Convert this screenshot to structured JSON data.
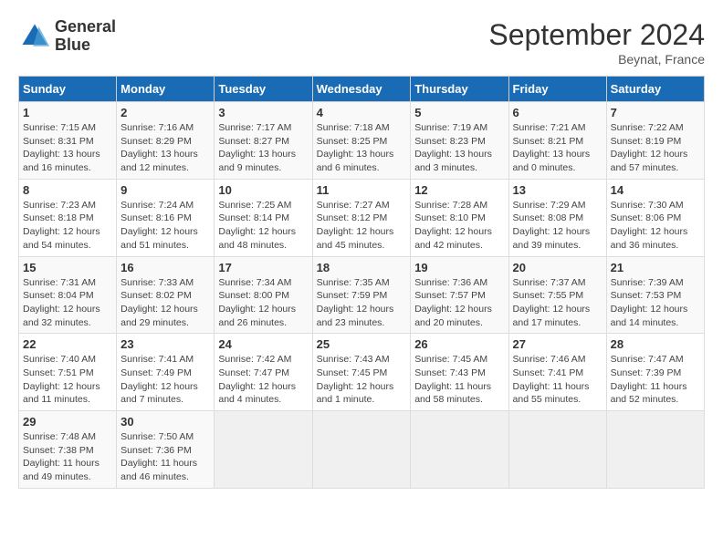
{
  "header": {
    "logo_line1": "General",
    "logo_line2": "Blue",
    "month_year": "September 2024",
    "location": "Beynat, France"
  },
  "weekdays": [
    "Sunday",
    "Monday",
    "Tuesday",
    "Wednesday",
    "Thursday",
    "Friday",
    "Saturday"
  ],
  "weeks": [
    [
      {
        "day": "1",
        "sunrise": "7:15 AM",
        "sunset": "8:31 PM",
        "daylight": "13 hours and 16 minutes."
      },
      {
        "day": "2",
        "sunrise": "7:16 AM",
        "sunset": "8:29 PM",
        "daylight": "13 hours and 12 minutes."
      },
      {
        "day": "3",
        "sunrise": "7:17 AM",
        "sunset": "8:27 PM",
        "daylight": "13 hours and 9 minutes."
      },
      {
        "day": "4",
        "sunrise": "7:18 AM",
        "sunset": "8:25 PM",
        "daylight": "13 hours and 6 minutes."
      },
      {
        "day": "5",
        "sunrise": "7:19 AM",
        "sunset": "8:23 PM",
        "daylight": "13 hours and 3 minutes."
      },
      {
        "day": "6",
        "sunrise": "7:21 AM",
        "sunset": "8:21 PM",
        "daylight": "13 hours and 0 minutes."
      },
      {
        "day": "7",
        "sunrise": "7:22 AM",
        "sunset": "8:19 PM",
        "daylight": "12 hours and 57 minutes."
      }
    ],
    [
      {
        "day": "8",
        "sunrise": "7:23 AM",
        "sunset": "8:18 PM",
        "daylight": "12 hours and 54 minutes."
      },
      {
        "day": "9",
        "sunrise": "7:24 AM",
        "sunset": "8:16 PM",
        "daylight": "12 hours and 51 minutes."
      },
      {
        "day": "10",
        "sunrise": "7:25 AM",
        "sunset": "8:14 PM",
        "daylight": "12 hours and 48 minutes."
      },
      {
        "day": "11",
        "sunrise": "7:27 AM",
        "sunset": "8:12 PM",
        "daylight": "12 hours and 45 minutes."
      },
      {
        "day": "12",
        "sunrise": "7:28 AM",
        "sunset": "8:10 PM",
        "daylight": "12 hours and 42 minutes."
      },
      {
        "day": "13",
        "sunrise": "7:29 AM",
        "sunset": "8:08 PM",
        "daylight": "12 hours and 39 minutes."
      },
      {
        "day": "14",
        "sunrise": "7:30 AM",
        "sunset": "8:06 PM",
        "daylight": "12 hours and 36 minutes."
      }
    ],
    [
      {
        "day": "15",
        "sunrise": "7:31 AM",
        "sunset": "8:04 PM",
        "daylight": "12 hours and 32 minutes."
      },
      {
        "day": "16",
        "sunrise": "7:33 AM",
        "sunset": "8:02 PM",
        "daylight": "12 hours and 29 minutes."
      },
      {
        "day": "17",
        "sunrise": "7:34 AM",
        "sunset": "8:00 PM",
        "daylight": "12 hours and 26 minutes."
      },
      {
        "day": "18",
        "sunrise": "7:35 AM",
        "sunset": "7:59 PM",
        "daylight": "12 hours and 23 minutes."
      },
      {
        "day": "19",
        "sunrise": "7:36 AM",
        "sunset": "7:57 PM",
        "daylight": "12 hours and 20 minutes."
      },
      {
        "day": "20",
        "sunrise": "7:37 AM",
        "sunset": "7:55 PM",
        "daylight": "12 hours and 17 minutes."
      },
      {
        "day": "21",
        "sunrise": "7:39 AM",
        "sunset": "7:53 PM",
        "daylight": "12 hours and 14 minutes."
      }
    ],
    [
      {
        "day": "22",
        "sunrise": "7:40 AM",
        "sunset": "7:51 PM",
        "daylight": "12 hours and 11 minutes."
      },
      {
        "day": "23",
        "sunrise": "7:41 AM",
        "sunset": "7:49 PM",
        "daylight": "12 hours and 7 minutes."
      },
      {
        "day": "24",
        "sunrise": "7:42 AM",
        "sunset": "7:47 PM",
        "daylight": "12 hours and 4 minutes."
      },
      {
        "day": "25",
        "sunrise": "7:43 AM",
        "sunset": "7:45 PM",
        "daylight": "12 hours and 1 minute."
      },
      {
        "day": "26",
        "sunrise": "7:45 AM",
        "sunset": "7:43 PM",
        "daylight": "11 hours and 58 minutes."
      },
      {
        "day": "27",
        "sunrise": "7:46 AM",
        "sunset": "7:41 PM",
        "daylight": "11 hours and 55 minutes."
      },
      {
        "day": "28",
        "sunrise": "7:47 AM",
        "sunset": "7:39 PM",
        "daylight": "11 hours and 52 minutes."
      }
    ],
    [
      {
        "day": "29",
        "sunrise": "7:48 AM",
        "sunset": "7:38 PM",
        "daylight": "11 hours and 49 minutes."
      },
      {
        "day": "30",
        "sunrise": "7:50 AM",
        "sunset": "7:36 PM",
        "daylight": "11 hours and 46 minutes."
      },
      null,
      null,
      null,
      null,
      null
    ]
  ]
}
